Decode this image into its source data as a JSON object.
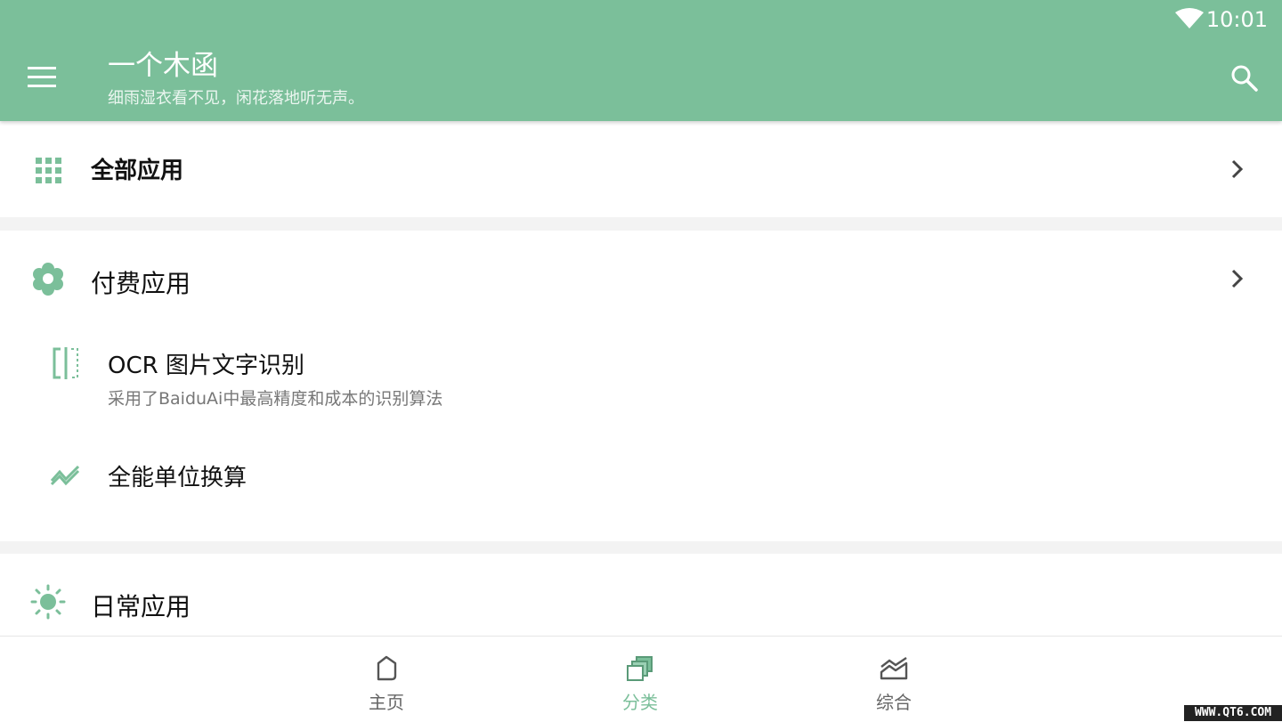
{
  "status": {
    "time": "10:01",
    "wifi_icon": "wifi-icon"
  },
  "appbar": {
    "title": "一个木函",
    "subtitle": "细雨湿衣看不见，闲花落地听无声。",
    "menu_icon": "menu-icon",
    "search_icon": "search-icon",
    "color": "#7bbf9a"
  },
  "categories": {
    "all": {
      "label": "全部应用",
      "icon": "grid-icon"
    },
    "paid": {
      "label": "付费应用",
      "icon": "flower-icon",
      "items": [
        {
          "title": "OCR 图片文字识别",
          "desc": "采用了BaiduAi中最高精度和成本的识别算法",
          "icon": "ocr-scan-icon"
        },
        {
          "title": "全能单位换算",
          "desc": "",
          "icon": "trend-icon"
        }
      ]
    },
    "daily": {
      "label": "日常应用",
      "icon": "sun-icon"
    }
  },
  "bottom_nav": [
    {
      "label": "主页",
      "icon": "home-icon",
      "active": false
    },
    {
      "label": "分类",
      "icon": "category-icon",
      "active": true
    },
    {
      "label": "综合",
      "icon": "chart-icon",
      "active": false
    }
  ],
  "colors": {
    "accent": "#7bbf9a",
    "inactive": "#666666"
  },
  "watermark": "WWW.QT6.COM"
}
